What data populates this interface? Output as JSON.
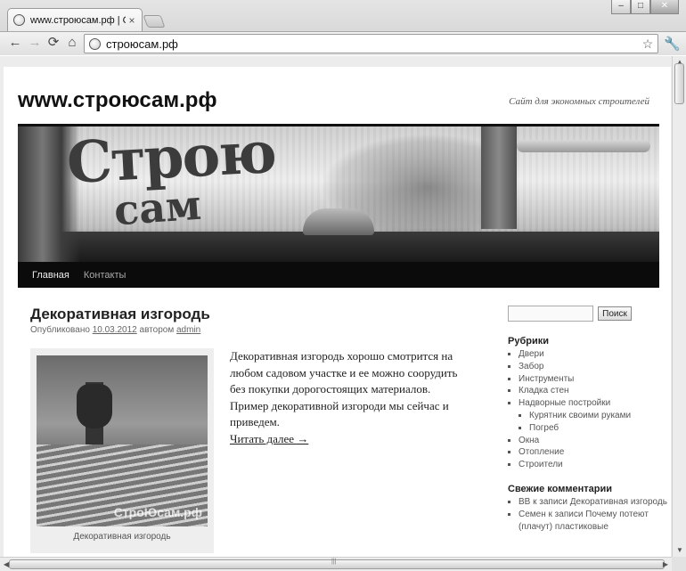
{
  "browser": {
    "tab_title": "www.строюсам.рф | Сайт ...",
    "tab_close": "×",
    "window_buttons": {
      "minimize": "–",
      "maximize": "□",
      "close": "✕"
    },
    "nav": {
      "back": "←",
      "forward": "→",
      "reload": "⟳",
      "home": "⌂"
    },
    "address": "строюсам.рф",
    "star": "☆",
    "wrench": "🔧"
  },
  "site": {
    "title": "www.строюсам.рф",
    "description": "Сайт для экономных строителей",
    "banner_logo_line1": "Строю",
    "banner_logo_line2": "сам"
  },
  "menu": {
    "items": [
      {
        "label": "Главная"
      },
      {
        "label": "Контакты"
      }
    ]
  },
  "post": {
    "title": "Декоративная изгородь",
    "meta_prefix": "Опубликовано",
    "date": "10.03.2012",
    "meta_author_prefix": "автором",
    "author": "admin",
    "image_watermark": "СтроЮсам.рф",
    "image_caption": "Декоративная изгородь",
    "body": "Декоративная изгородь хорошо смотрится на любом садовом участке и ее можно соорудить без покупки дорогостоящих материалов. Пример декоративной изгороди мы сейчас и приведем.",
    "read_more": "Читать далее →"
  },
  "sidebar": {
    "search_value": "",
    "search_button": "Поиск",
    "categories_title": "Рубрики",
    "categories": [
      "Двери",
      "Забор",
      "Инструменты",
      "Кладка стен",
      "Надворные постройки"
    ],
    "subcategories": [
      "Курятник своими руками",
      "Погреб"
    ],
    "categories_after": [
      "Окна",
      "Отопление",
      "Строители"
    ],
    "comments_title": "Свежие комментарии",
    "comments": [
      "ВВ к записи Декоративная изгородь",
      "Семен к записи Почему потеют (плачут) пластиковые"
    ]
  },
  "scrollbars": {
    "up": "▲",
    "down": "▼",
    "left": "◀",
    "right": "▶",
    "grip": "|||"
  }
}
